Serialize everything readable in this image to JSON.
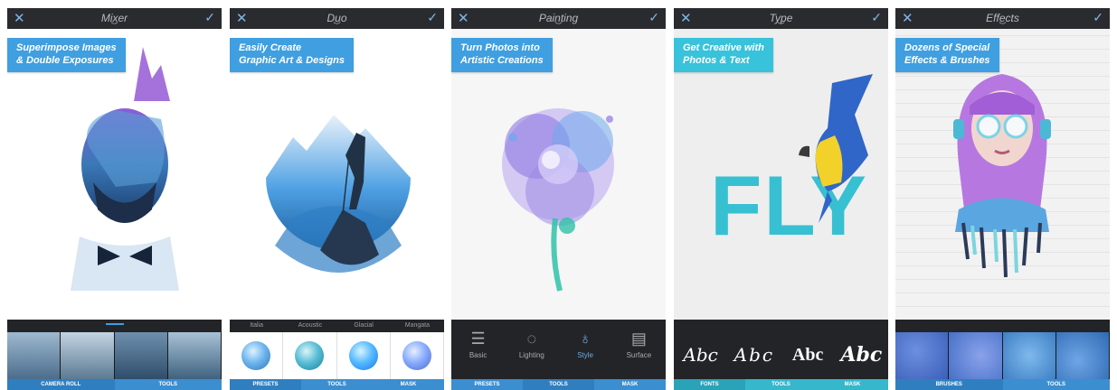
{
  "colors": {
    "accent": "#3f9fe0",
    "accent_cyan": "#38c2db",
    "toolbar": "#2a2b2f",
    "tray": "#232427"
  },
  "icons": {
    "close": "close-icon",
    "confirm": "checkmark-icon",
    "expand": "chevron-down-icon"
  },
  "panels": [
    {
      "title": "Mixer",
      "caption": [
        "Superimpose Images",
        "& Double Exposures"
      ],
      "tabs": [
        "CAMERA ROLL",
        "TOOLS"
      ]
    },
    {
      "title": "Duo",
      "caption": [
        "Easily Create",
        "Graphic Art & Designs"
      ],
      "presets": [
        "Italia",
        "Acoustic",
        "Glacial",
        "Mangata"
      ],
      "tabs": [
        "PRESETS",
        "TOOLS",
        "MASK"
      ]
    },
    {
      "title": "Painting",
      "caption": [
        "Turn Photos into",
        "Artistic Creations"
      ],
      "tools": [
        "Basic",
        "Lighting",
        "Style",
        "Surface"
      ],
      "tabs": [
        "PRESETS",
        "TOOLS",
        "MASK"
      ]
    },
    {
      "title": "Type",
      "caption": [
        "Get Creative with",
        "Photos & Text"
      ],
      "artwork_text": "FLY",
      "font_samples": [
        "Abc",
        "Abc",
        "Abc",
        "Abc"
      ],
      "tabs": [
        "FONTS",
        "TOOLS",
        "MASK"
      ]
    },
    {
      "title": "Effects",
      "caption": [
        "Dozens of Special",
        "Effects & Brushes"
      ],
      "tabs": [
        "BRUSHES",
        "TOOLS"
      ]
    }
  ]
}
